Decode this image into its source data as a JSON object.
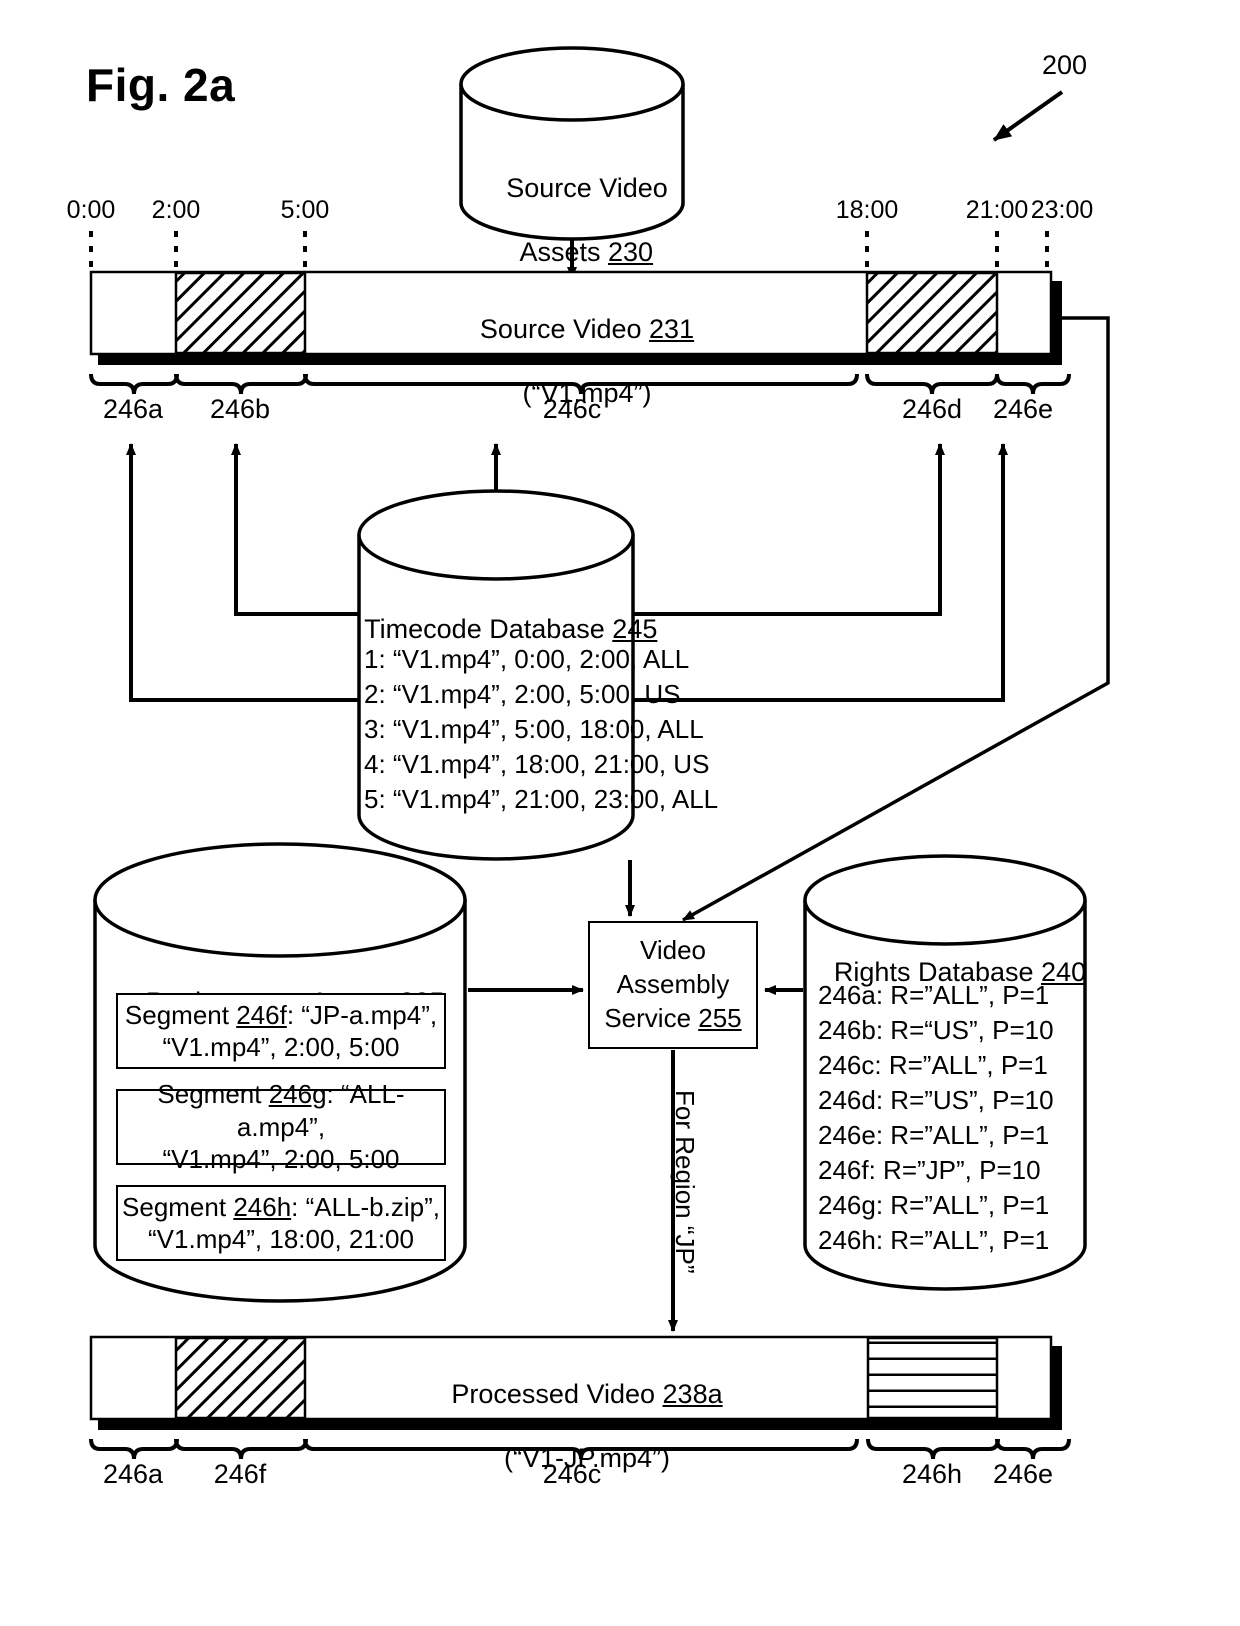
{
  "figure": {
    "title": "Fig. 2a",
    "ref_number": "200"
  },
  "source_timeline": {
    "ticks": [
      "0:00",
      "2:00",
      "5:00",
      "18:00",
      "21:00",
      "23:00"
    ],
    "title": "Source Video 231",
    "title_text": "Source Video ",
    "title_ref": "231",
    "subtitle": "(“V1.mp4”)",
    "segments": [
      "246a",
      "246b",
      "246c",
      "246d",
      "246e"
    ]
  },
  "source_assets_db": {
    "title_text": "Source Video",
    "title_text2": "Assets ",
    "title_ref": "230"
  },
  "timecode_db": {
    "title_text": "Timecode Database ",
    "title_ref": "245",
    "rows": [
      "1: “V1.mp4”, 0:00, 2:00, ALL",
      "2: “V1.mp4”, 2:00, 5:00, US",
      "3: “V1.mp4”, 5:00, 18:00, ALL",
      "4: “V1.mp4”, 18:00, 21:00, US",
      "5: “V1.mp4”, 21:00, 23:00, ALL"
    ]
  },
  "replacement_assets_db": {
    "title_text": "Replacement Assets ",
    "title_ref": "235",
    "segments": [
      {
        "line1_pre": "Segment ",
        "ref": "246f",
        "line1_post": ": “JP-a.mp4”,",
        "line2": "“V1.mp4”, 2:00, 5:00"
      },
      {
        "line1_pre": "Segment ",
        "ref": "246g",
        "line1_post": ": “ALL-a.mp4”,",
        "line2": "“V1.mp4”, 2:00, 5:00"
      },
      {
        "line1_pre": "Segment ",
        "ref": "246h",
        "line1_post": ": “ALL-b.zip”,",
        "line2": "“V1.mp4”, 18:00, 21:00"
      }
    ]
  },
  "rights_db": {
    "title_text": "Rights Database ",
    "title_ref": "240",
    "rows": [
      "246a: R=”ALL”, P=1",
      "246b: R=“US”, P=10",
      "246c: R=”ALL”, P=1",
      "246d: R=”US”, P=10",
      "246e: R=”ALL”, P=1",
      "246f: R=”JP”, P=10",
      "246g: R=”ALL”, P=1",
      "246h: R=”ALL”, P=1"
    ]
  },
  "video_assembly_service": {
    "line1": "Video",
    "line2": "Assembly",
    "line3_pre": "Service ",
    "line3_ref": "255",
    "output_label": "For Region “JP”"
  },
  "processed_timeline": {
    "title_text": "Processed Video ",
    "title_ref": "238a",
    "subtitle": "(“V1-JP.mp4”)",
    "segments": [
      "246a",
      "246f",
      "246c",
      "246h",
      "246e"
    ]
  },
  "colors": {
    "ink": "#000000",
    "paper": "#ffffff"
  }
}
